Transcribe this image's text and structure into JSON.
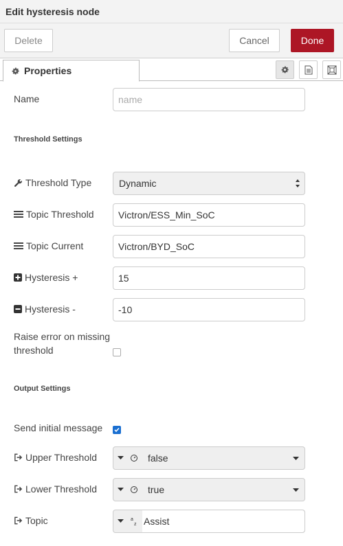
{
  "dialog": {
    "title": "Edit hysteresis node"
  },
  "toolbar": {
    "delete_label": "Delete",
    "cancel_label": "Cancel",
    "done_label": "Done"
  },
  "tabs": {
    "properties_label": "Properties"
  },
  "form": {
    "name": {
      "label": "Name",
      "placeholder": "name",
      "value": ""
    },
    "threshold_section": "Threshold Settings",
    "threshold_type": {
      "label": "Threshold Type",
      "value": "Dynamic"
    },
    "topic_threshold": {
      "label": "Topic Threshold",
      "value": "Victron/ESS_Min_SoC"
    },
    "topic_current": {
      "label": "Topic Current",
      "value": "Victron/BYD_SoC"
    },
    "hysteresis_plus": {
      "label": "Hysteresis +",
      "value": "15"
    },
    "hysteresis_minus": {
      "label": "Hysteresis -",
      "value": "-10"
    },
    "raise_error": {
      "label_line1": "Raise error on missing",
      "label_line2": "threshold",
      "checked": false
    },
    "output_section": "Output Settings",
    "send_initial": {
      "label": "Send initial message",
      "checked": true
    },
    "upper_threshold": {
      "label": "Upper Threshold",
      "value": "false"
    },
    "lower_threshold": {
      "label": "Lower Threshold",
      "value": "true"
    },
    "topic": {
      "label": "Topic",
      "value": "Assist"
    }
  },
  "colors": {
    "done_button": "#ad1625",
    "checkbox_checked": "#1a6fd1"
  }
}
